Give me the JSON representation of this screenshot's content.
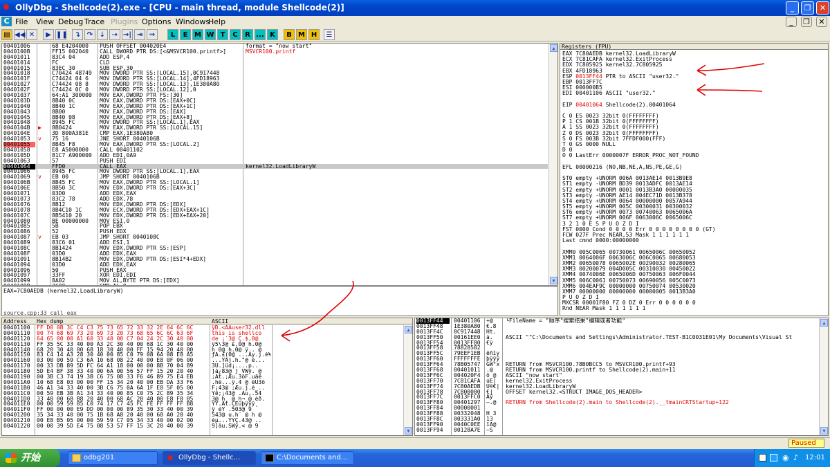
{
  "title": "OllyDbg - Shellcode(2).exe - [CPU - main thread, module Shellcode(2)]",
  "menu": [
    "File",
    "View",
    "Debug",
    "Trace",
    "Plugins",
    "Options",
    "Windows",
    "Help"
  ],
  "toolbar_letters": [
    "L",
    "E",
    "M",
    "W",
    "T",
    "C",
    "R",
    "...",
    "K",
    "B",
    "M",
    "H"
  ],
  "disasm": {
    "rows": [
      {
        "a": "00401006",
        "m": " ",
        "h": "68 E4204000",
        "i": "PUSH OFFSET 004020E4",
        "c": "format = \"now start\""
      },
      {
        "a": "0040100B",
        "m": " ",
        "h": "FF15 002040",
        "i": "CALL DWORD PTR DS:[<&MSVCR100.printf>]",
        "c": "MSVCR100.printf",
        "cr": 1
      },
      {
        "a": "00401011",
        "m": " ",
        "h": "83C4 04",
        "i": "ADD ESP,4",
        "c": ""
      },
      {
        "a": "00401014",
        "m": " ",
        "h": "FC",
        "i": "CLD",
        "c": ""
      },
      {
        "a": "00401015",
        "m": " ",
        "h": "83EC 30",
        "i": "SUB ESP,30",
        "c": ""
      },
      {
        "a": "00401018",
        "m": " ",
        "h": "C70424 48749",
        "i": "MOV DWORD PTR SS:[LOCAL.15],0C917448",
        "c": ""
      },
      {
        "a": "0040101F",
        "m": " ",
        "h": "C74424 04 6",
        "i": "MOV DWORD PTR SS:[LOCAL.14],4FD18963",
        "c": ""
      },
      {
        "a": "00401027",
        "m": " ",
        "h": "C74424 08 8",
        "i": "MOV DWORD PTR SS:[LOCAL.13],1E380A80",
        "c": ""
      },
      {
        "a": "0040102F",
        "m": " ",
        "h": "C74424 0C 0",
        "i": "MOV DWORD PTR SS:[LOCAL.12],0",
        "c": ""
      },
      {
        "a": "00401037",
        "m": " ",
        "h": "64:A1 300000",
        "i": "MOV EAX,DWORD PTR FS:[30]",
        "c": ""
      },
      {
        "a": "0040103D",
        "m": " ",
        "h": "8B40 0C",
        "i": "MOV EAX,DWORD PTR DS:[EAX+0C]",
        "c": ""
      },
      {
        "a": "00401040",
        "m": " ",
        "h": "8B40 1C",
        "i": "MOV EAX,DWORD PTR DS:[EAX+1C]",
        "c": ""
      },
      {
        "a": "00401043",
        "m": " ",
        "h": "8B00",
        "i": "MOV EAX,DWORD PTR DS:[EAX]",
        "c": ""
      },
      {
        "a": "00401045",
        "m": " ",
        "h": "8B40 08",
        "i": "MOV EAX,DWORD PTR DS:[EAX+8]",
        "c": ""
      },
      {
        "a": "00401048",
        "m": " ",
        "h": "8945 FC",
        "i": "MOV DWORD PTR SS:[LOCAL.1],EAX",
        "c": ""
      },
      {
        "a": "0040104B",
        "m": "▶",
        "h": "8B0424",
        "i": "MOV EAX,DWORD PTR SS:[LOCAL.15]",
        "c": ""
      },
      {
        "a": "0040104E",
        "m": " ",
        "h": "3D 800A381E",
        "i": "CMP EAX,1E380A80",
        "c": ""
      },
      {
        "a": "00401053",
        "m": "v",
        "h": "75 16",
        "i": "JNE SHORT 0040106B",
        "c": ""
      },
      {
        "a": "00401055",
        "m": " ",
        "h": "8B45 F8",
        "i": "MOV EAX,DWORD PTR SS:[LOCAL.2]",
        "c": "",
        "ar": 1
      },
      {
        "a": "00401058",
        "m": " ",
        "h": "E8 A5000000",
        "i": "CALL 00401102",
        "c": ""
      },
      {
        "a": "0040105D",
        "m": " ",
        "h": "81C7 A900000",
        "i": "ADD EDI,0A9",
        "c": ""
      },
      {
        "a": "00401063",
        "m": " ",
        "h": "57",
        "i": "PUSH EDI",
        "c": ""
      },
      {
        "a": "00401064",
        "m": " ",
        "h": "FFD0",
        "i": "CALL EAX",
        "c": "kernel32.LoadLibraryW",
        "cur": 1
      },
      {
        "a": "00401066",
        "m": " ",
        "h": "8945 FC",
        "i": "MOV DWORD PTR SS:[LOCAL.1],EAX",
        "c": ""
      },
      {
        "a": "00401069",
        "m": "v",
        "h": "EB 00",
        "i": "JMP SHORT 0040106B",
        "c": ""
      },
      {
        "a": "0040106B",
        "m": " ",
        "h": "8B45 FC",
        "i": "MOV EAX,DWORD PTR SS:[LOCAL.1]",
        "c": ""
      },
      {
        "a": "0040106E",
        "m": " ",
        "h": "8B50 3C",
        "i": "MOV EDX,DWORD PTR DS:[EAX+3C]",
        "c": ""
      },
      {
        "a": "00401071",
        "m": " ",
        "h": "03D0",
        "i": "ADD EDX,EAX",
        "c": ""
      },
      {
        "a": "00401073",
        "m": " ",
        "h": "83C2 78",
        "i": "ADD EDX,78",
        "c": ""
      },
      {
        "a": "00401076",
        "m": " ",
        "h": "8B12",
        "i": "MOV EDX,DWORD PTR DS:[EDX]",
        "c": ""
      },
      {
        "a": "00401078",
        "m": " ",
        "h": "8B4C10 1C",
        "i": "MOV ECX,DWORD PTR DS:[EDX+EAX+1C]",
        "c": ""
      },
      {
        "a": "0040107C",
        "m": " ",
        "h": "8B5410 20",
        "i": "MOV EDX,DWORD PTR DS:[EDX+EAX+20]",
        "c": ""
      },
      {
        "a": "00401080",
        "m": " ",
        "h": "BE 00000000",
        "i": "MOV ESI,0",
        "c": ""
      },
      {
        "a": "00401085",
        "m": " ",
        "h": "5B",
        "i": "POP EBX",
        "c": ""
      },
      {
        "a": "00401086",
        "m": " ",
        "h": "52",
        "i": "PUSH EDX",
        "c": ""
      },
      {
        "a": "00401087",
        "m": "v",
        "h": "EB 03",
        "i": "JMP SHORT 0040108C",
        "c": ""
      },
      {
        "a": "00401089",
        "m": " ",
        "h": "83C6 01",
        "i": "ADD ESI,1",
        "c": ""
      },
      {
        "a": "0040108C",
        "m": " ",
        "h": "8B1424",
        "i": "MOV EDX,DWORD PTR SS:[ESP]",
        "c": ""
      },
      {
        "a": "0040108F",
        "m": " ",
        "h": "03D0",
        "i": "ADD EDX,EAX",
        "c": ""
      },
      {
        "a": "00401091",
        "m": " ",
        "h": "8B14B2",
        "i": "MOV EDX,DWORD PTR DS:[ESI*4+EDX]",
        "c": ""
      },
      {
        "a": "00401094",
        "m": " ",
        "h": "03D0",
        "i": "ADD EDX,EAX",
        "c": ""
      },
      {
        "a": "00401096",
        "m": " ",
        "h": "50",
        "i": "PUSH EAX",
        "c": ""
      },
      {
        "a": "00401097",
        "m": " ",
        "h": "33FF",
        "i": "XOR EDI,EDI",
        "c": ""
      },
      {
        "a": "00401099",
        "m": " ",
        "h": "8A02",
        "i": "MOV AL,BYTE PTR DS:[EDX]",
        "c": ""
      },
      {
        "a": "0040109B",
        "m": " ",
        "h": "3C00",
        "i": "CMP AL,0",
        "c": ""
      }
    ],
    "info1": "EAX=7C80AEDB (kernel32.LoadLibraryW)",
    "info2": "source.cpp:33 call eax"
  },
  "registers": {
    "header": "Registers (FPU)",
    "lines": [
      {
        "t": "EAX 7C80AEDB kernel32.LoadLibraryW"
      },
      {
        "t": "ECX 7C81CAFA kernel32.ExitProcess"
      },
      {
        "t": "EDX 7C805925 kernel32.7C805925"
      },
      {
        "t": "EBX 4FD18963"
      },
      {
        "t": "ESP 0013FF44 PTR to ASCII \"user32.\"",
        "r": 1
      },
      {
        "t": "EBP 0013FF7C"
      },
      {
        "t": "ESI 000000B5"
      },
      {
        "t": "EDI 00401106 ASCII \"user32.\""
      },
      {
        "t": ""
      },
      {
        "t": "EIP 00401064 Shellcode(2).00401064",
        "r": 1
      },
      {
        "t": ""
      },
      {
        "t": "C 0  ES 0023 32bit 0(FFFFFFFF)"
      },
      {
        "t": "P 1  CS 001B 32bit 0(FFFFFFFF)"
      },
      {
        "t": "A 1  SS 0023 32bit 0(FFFFFFFF)"
      },
      {
        "t": "Z 0  DS 0023 32bit 0(FFFFFFFF)"
      },
      {
        "t": "S 0  FS 003B 32bit 7FFDF000(FFF)"
      },
      {
        "t": "T 0  GS 0000 NULL"
      },
      {
        "t": "D 0"
      },
      {
        "t": "O 0   LastErr 0000007F ERROR_PROC_NOT_FOUND"
      },
      {
        "t": ""
      },
      {
        "t": "EFL 00000216 (NO,NB,NE,A,NS,PE,GE,G)"
      },
      {
        "t": ""
      },
      {
        "t": "ST0 empty +UNORM 006A 0013AE14 0013B9E8"
      },
      {
        "t": "ST1 empty -UNORM BD39 0013ADFC 0013AE14"
      },
      {
        "t": "ST2 empty +UNORM 0001 0013B3A0 00000035"
      },
      {
        "t": "ST3 empty -UNORM AE14 004EC71D 0013B378"
      },
      {
        "t": "ST4 empty +UNORM 0064 00000000 0057A944"
      },
      {
        "t": "ST5 empty +UNORM 005C 00300031 00300032"
      },
      {
        "t": "ST6 empty +UNORM 0073 00740063 0065006A"
      },
      {
        "t": "ST7 empty +UNORM 006F 0063006C 0065006C"
      },
      {
        "t": "               3 2 1 0      E S P U O Z D I"
      },
      {
        "t": "FST 0000  Cond 0 0 0 0  Err 0 0 0 0 0 0 0 0  (GT)"
      },
      {
        "t": "FCW 027F  Prec NEAR,53  Mask    1 1 1 1 1 1"
      },
      {
        "t": "Last cmnd 0000:00000000"
      },
      {
        "t": ""
      },
      {
        "t": "XMM0 005C0065 00730061 0065006C 00650052"
      },
      {
        "t": "XMM1 0064006F 0063006C 006C0065 00680053"
      },
      {
        "t": "XMM2 00650078 0065002E 00290032 00280065"
      },
      {
        "t": "XMM3 00200079 004D005C 00310030 00450022"
      },
      {
        "t": "XMM4 0074006E 0065006D 00750063 006F0044"
      },
      {
        "t": "XMM5 006C0061 00750073 00690056 005C0073"
      },
      {
        "t": "XMM6 004EAF9C 00000000 00750074 00530020"
      },
      {
        "t": "XMM7 00000000 00000000 00000005 0013B3A0"
      },
      {
        "t": "                                P U O Z D I"
      },
      {
        "t": "MXCSR 00001F80  FZ 0 DZ 0   Err  0 0 0 0 0 0"
      },
      {
        "t": "                Rnd NEAR   Mask  1 1 1 1 1 1"
      }
    ]
  },
  "dump": {
    "headers": [
      "Address",
      "Hex dump",
      "ASCII"
    ],
    "rows": [
      {
        "a": "00401100",
        "h": "FF D0 0B 3C C4 C3 75 73 65 72 33 32 2E 64 6C 6C",
        "s": "ÿÐ.<ÄÃuser32.dll"
      },
      {
        "a": "00401110",
        "h": "00 74 68 69 73 20 69 73 20 73 68 65 6C 6C 63 6F",
        "s": " this is shellco",
        "hl": 1
      },
      {
        "a": "00401120",
        "h": "64 65 00 00 A1 60 33 40 00 C7 04 24 2C 30 40 00",
        "s": "de  ¡`3@ Ç.$,0@ "
      },
      {
        "a": "00401130",
        "h": "FF 35 5C 33 40 00 A3 2C 30 40 00 68 1C 30 40 00",
        "s": "ÿ5\\3@ £,0@ h.0@ "
      },
      {
        "a": "00401140",
        "h": "68 20 30 40 00 68 18 30 40 00 FF 15 94 20 40 00",
        "s": "h 0@ h.0@ ÿ.. @ "
      },
      {
        "a": "00401150",
        "h": "83 C4 14 A3 28 30 40 00 85 C0 79 08 6A 08 E8 A5",
        "s": "ƒÄ.£(0@ ...Ày.j.è¥"
      },
      {
        "a": "00401160",
        "h": "03 00 00 59 C3 6A 10 68 08 22 40 00 E8 0F 06 00",
        "s": "...YÃj.h.\"@ è..."
      },
      {
        "a": "00401170",
        "h": "00 33 DB 89 5D FC 64 A1 18 00 00 00 8B 70 04 89",
        "s": " 3Û.]üd¡....p.."
      },
      {
        "a": "00401180",
        "h": "5D E4 BF 38 33 40 00 6A 00 56 57 FF 15 20 20 40",
        "s": "]ä¿83@ j VWÿ.  @"
      },
      {
        "a": "00401190",
        "h": "00 3B C3 74 19 3B C6 75 08 33 F6 46 89 75 E4 EB",
        "s": " ;Ãt.;Æu.3öF.uäë"
      },
      {
        "a": "004011A0",
        "h": "10 68 E8 03 00 00 FF 15 34 20 40 00 EB DA 33 F6",
        "s": ".hè...ÿ.4 @ ëÚ3ö"
      },
      {
        "a": "004011B0",
        "h": "46 A1 34 33 40 00 3B C6 75 0A 6A 1F E8 5F 05 00",
        "s": "F¡43@ ;Æu.j.è_.."
      },
      {
        "a": "004011C0",
        "h": "00 59 EB 3B A1 34 33 40 00 85 C0 75 2C 89 35 34",
        "s": " Yë;¡43@ .Àu,.54"
      },
      {
        "a": "004011D0",
        "h": "33 40 00 68 B8 20 40 00 68 AC 20 40 00 E8 F0 05",
        "s": "3@ h¸ @ h¬ @ èð."
      },
      {
        "a": "004011E0",
        "h": "00 00 59 59 85 C0 74 17 C7 45 FC FE FF FF FF B8",
        "s": "  YY.Àt.ÇEüþÿÿÿ¸"
      },
      {
        "a": "004011F0",
        "h": "FF 00 00 00 E9 DD 00 00 00 89 35 30 33 40 00 39",
        "s": "ÿ   éÝ   .503@ 9"
      },
      {
        "a": "00401200",
        "h": "35 34 33 40 00 75 1B 68 A8 20 40 00 68 A0 20 40",
        "s": "543@ u.h¨ @ h  @"
      },
      {
        "a": "00401210",
        "h": "00 E8 B5 05 00 00 59 59 C7 05 34 33 40 00 02 00",
        "s": " èµ...YYÇ.43@ .."
      },
      {
        "a": "00401220",
        "h": "00 00 39 5D E4 75 08 53 57 FF 15 3C 20 40 00 39",
        "s": "  9]äu.SWÿ.< @ 9"
      }
    ]
  },
  "stack": {
    "rows": [
      {
        "a": "0013FF44",
        "v": "00401106",
        "s": "+@",
        "c": "└FileName = \"顺序\"搜索结果\"编辑或者功能\"",
        "cur": 1
      },
      {
        "a": "0013FF48",
        "v": "1E380A80",
        "s": "€.8",
        "c": ""
      },
      {
        "a": "0013FF4C",
        "v": "0C917448",
        "s": "Ht.",
        "c": ""
      },
      {
        "a": "0013FF50",
        "v": "00161EE0",
        "s": "à.",
        "c": "ASCII \"\"C:\\Documents and Settings\\Administrator.TEST-B1C0031E01\\My Documents\\Visual St"
      },
      {
        "a": "0013FF54",
        "v": "0013FF80",
        "s": "€ÿ",
        "c": ""
      },
      {
        "a": "0013FF58",
        "v": "78828582",
        "s": "",
        "c": ""
      },
      {
        "a": "0013FF5C",
        "v": "79EEF1EB",
        "s": "ëñîy",
        "c": ""
      },
      {
        "a": "0013FF60",
        "v": "FFFFFFFE",
        "s": "þÿÿÿ",
        "c": ""
      },
      {
        "a": "0013FF64",
        "v": "78B05747",
        "s": "GW°x",
        "c": "RETURN from MSVCR100.78B0BCC5 to MSVCR100.printf+93"
      },
      {
        "a": "0013FF68",
        "v": "00401011",
        "s": ".@",
        "c": "RETURN from MSVCR100.printf to Shellcode(2).main+11"
      },
      {
        "a": "0013FF6C",
        "v": "004020F4",
        "s": "ô @",
        "c": "ASCII \"now start\""
      },
      {
        "a": "0013FF70",
        "v": "7C81CAFA",
        "s": "úÊ|",
        "c": "kernel32.ExitProcess"
      },
      {
        "a": "0013FF74",
        "v": "7C80AEDB",
        "s": "Û®€|",
        "c": "kernel32.LoadLibraryW"
      },
      {
        "a": "0013FF78",
        "v": "7C800000",
        "s": "  €|",
        "c": "OFFSET kernel32.<STRUCT IMAGE_DOS_HEADER>"
      },
      {
        "a": "0013FF7C",
        "v": "0013FFC0",
        "s": "Àÿ",
        "c": ""
      },
      {
        "a": "0013FF80",
        "v": "00401297",
        "s": "—.@",
        "c": "RETURN from Shellcode(2).main to Shellcode(2).__tmainCRTStartup+122",
        "red": 1
      },
      {
        "a": "0013FF84",
        "v": "00000001",
        "s": "",
        "c": ""
      },
      {
        "a": "0013FF88",
        "v": "00332048",
        "s": "H 3",
        "c": ""
      },
      {
        "a": "0013FF8C",
        "v": "003331A0",
        "s": " 13",
        "c": ""
      },
      {
        "a": "0013FF90",
        "v": "0040C0EE",
        "s": "îÀ@",
        "c": ""
      },
      {
        "a": "0013FF94",
        "v": "00128A7E",
        "s": "~Š",
        "c": ""
      }
    ]
  },
  "status": {
    "paused": "Paused"
  },
  "taskbar": {
    "start": "开始",
    "tasks": [
      "odbg201",
      "OllyDbg - Shellc...",
      "C:\\Documents and..."
    ],
    "clock": "12:01"
  }
}
